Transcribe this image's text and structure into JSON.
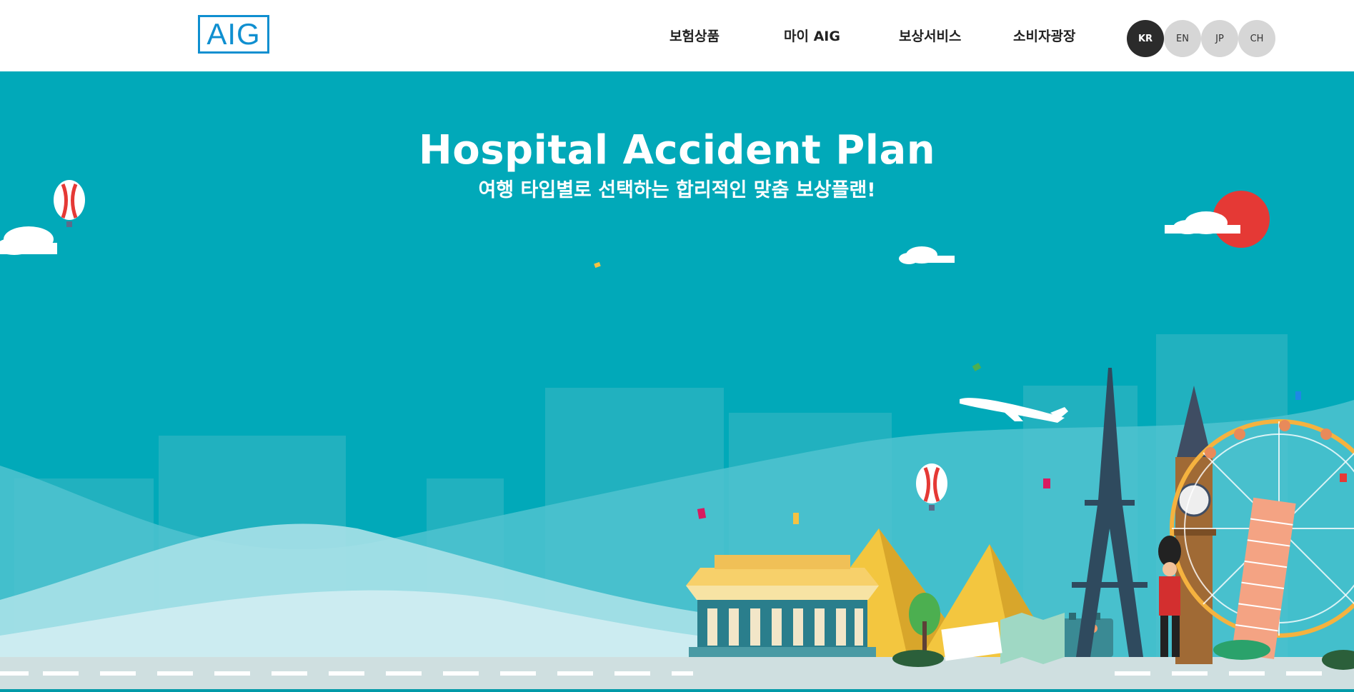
{
  "header": {
    "logo_text": "AIG",
    "nav": [
      {
        "label": "보험상품"
      },
      {
        "label": "마이 AIG"
      },
      {
        "label": "보상서비스"
      },
      {
        "label": "소비자광장"
      }
    ],
    "languages": [
      {
        "label": "KR",
        "active": true
      },
      {
        "label": "EN",
        "active": false
      },
      {
        "label": "JP",
        "active": false
      },
      {
        "label": "CH",
        "active": false
      }
    ]
  },
  "hero": {
    "title": "Hospital Accident Plan",
    "subtitle": "여행 타입별로 선택하는 합리적인 맞춤 보상플랜!"
  },
  "colors": {
    "brand_blue": "#0f8fd0",
    "hero_background": "#01a9b9",
    "active_language": "#2b2b2b",
    "inactive_language": "#d6d6d6"
  },
  "icons": [
    "hot-air-balloon-icon",
    "airplane-icon",
    "eiffel-tower-icon",
    "big-ben-icon",
    "ferris-wheel-icon",
    "pyramid-icon",
    "palace-icon",
    "royal-guard-icon",
    "suitcase-icon",
    "sun-icon",
    "cloud-icon"
  ]
}
